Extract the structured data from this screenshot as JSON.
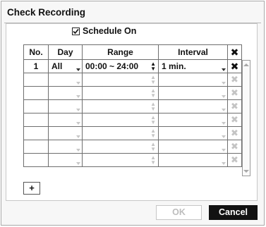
{
  "dialog": {
    "title": "Check Recording",
    "schedule_on_label": "Schedule On",
    "schedule_on_checked": true
  },
  "table": {
    "headers": {
      "no": "No.",
      "day": "Day",
      "range": "Range",
      "interval": "Interval",
      "delete": "✖"
    },
    "rows": [
      {
        "no": "1",
        "day": "All",
        "range": "00:00 ~ 24:00",
        "interval": "1 min.",
        "active": true
      },
      {
        "no": "",
        "day": "",
        "range": "",
        "interval": "",
        "active": false
      },
      {
        "no": "",
        "day": "",
        "range": "",
        "interval": "",
        "active": false
      },
      {
        "no": "",
        "day": "",
        "range": "",
        "interval": "",
        "active": false
      },
      {
        "no": "",
        "day": "",
        "range": "",
        "interval": "",
        "active": false
      },
      {
        "no": "",
        "day": "",
        "range": "",
        "interval": "",
        "active": false
      },
      {
        "no": "",
        "day": "",
        "range": "",
        "interval": "",
        "active": false
      },
      {
        "no": "",
        "day": "",
        "range": "",
        "interval": "",
        "active": false
      }
    ]
  },
  "buttons": {
    "add": "+",
    "ok": "OK",
    "cancel": "Cancel"
  },
  "icons": {
    "delete": "close-x-icon",
    "spinner": "up-down-spinner-icon",
    "dropdown": "dropdown-arrow-icon",
    "checkmark": "checkmark-icon"
  },
  "colors": {
    "cancel_bg": "#121212",
    "ok_disabled_text": "#bdbdbd",
    "grid_border": "#6e6e6e",
    "disabled_icon": "#c4c4c4"
  }
}
